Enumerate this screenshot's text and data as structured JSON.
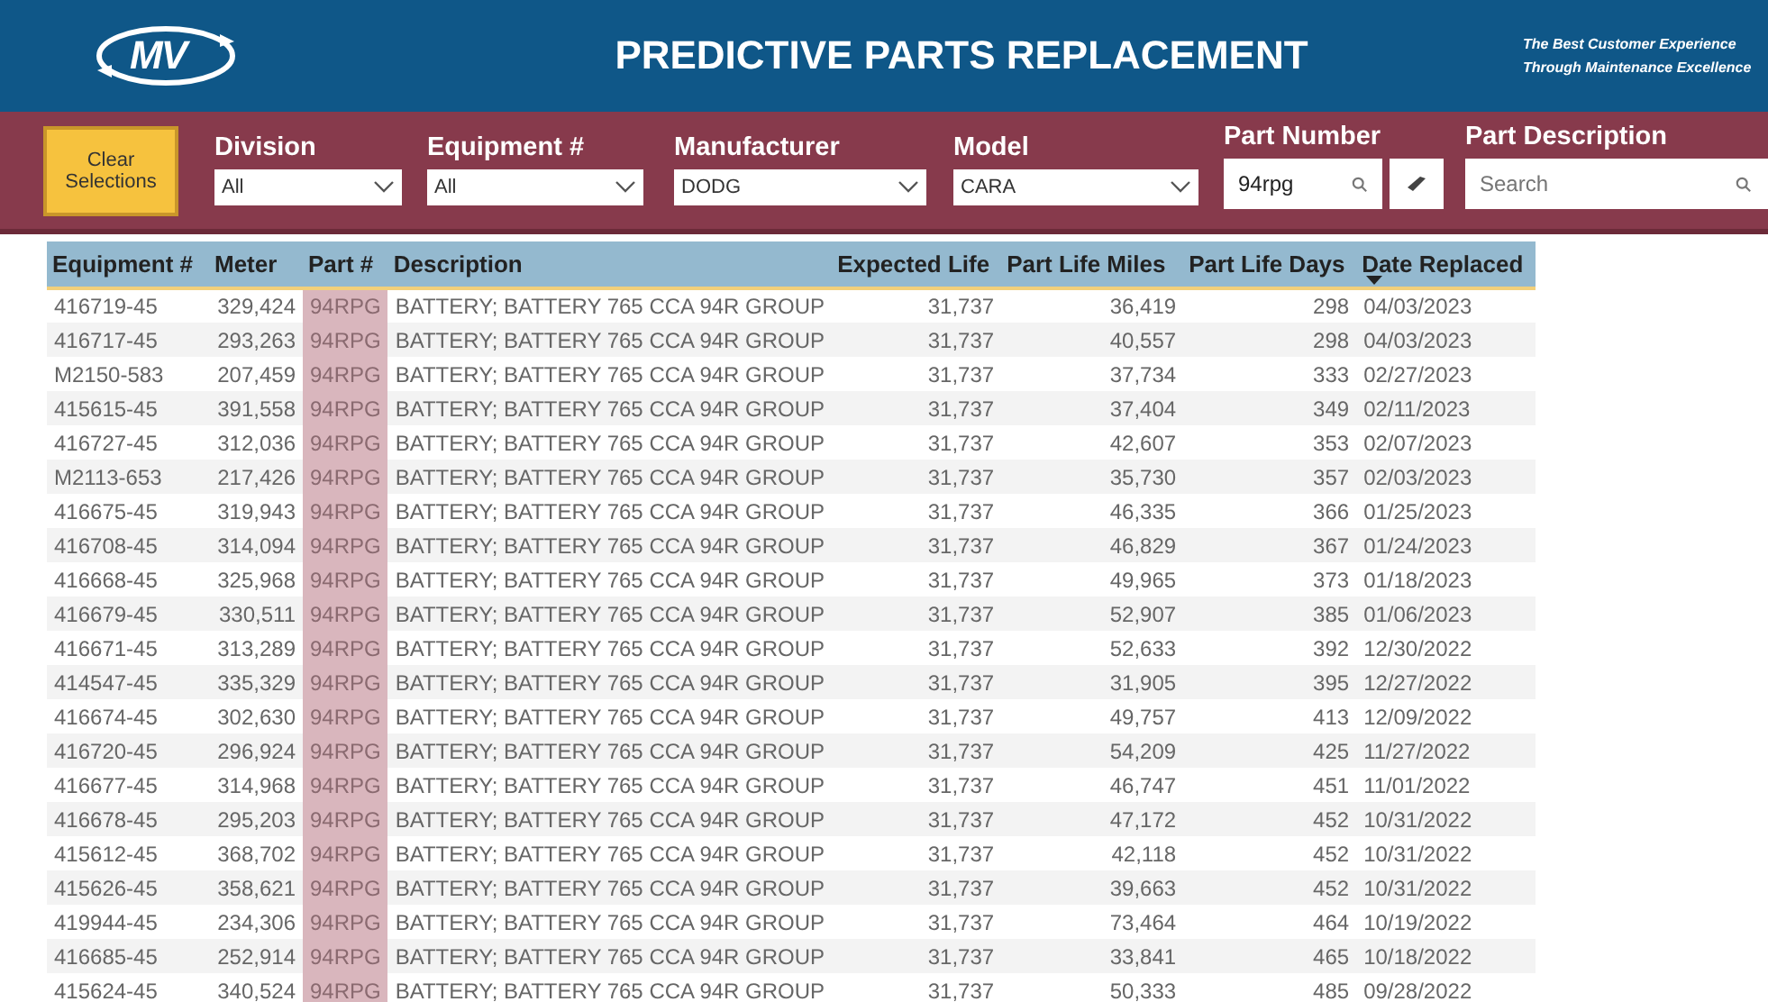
{
  "header": {
    "logo": "MV",
    "title": "PREDICTIVE PARTS REPLACEMENT",
    "tagline": [
      "The Best Customer Experience",
      "Through Maintenance Excellence"
    ]
  },
  "filters": {
    "clear_button": "Clear Selections",
    "dropdowns": [
      {
        "label": "Division",
        "value": "All"
      },
      {
        "label": "Equipment #",
        "value": "All"
      },
      {
        "label": "Manufacturer",
        "value": "DODG"
      },
      {
        "label": "Model",
        "value": "CARA"
      }
    ],
    "part_number": {
      "label": "Part Number",
      "value": "94rpg"
    },
    "part_description": {
      "label": "Part Description",
      "placeholder": "Search"
    }
  },
  "table": {
    "columns": [
      {
        "label": "Equipment #",
        "kind": "text",
        "sorted": false
      },
      {
        "label": "Meter",
        "kind": "number",
        "sorted": false
      },
      {
        "label": "Part #",
        "kind": "part",
        "sorted": false
      },
      {
        "label": "Description",
        "kind": "text",
        "sorted": false
      },
      {
        "label": "Expected Life",
        "kind": "number",
        "sorted": false
      },
      {
        "label": "Part Life Miles",
        "kind": "number",
        "sorted": false
      },
      {
        "label": "Part Life Days",
        "kind": "number",
        "sorted": false
      },
      {
        "label": "Date Replaced",
        "kind": "text",
        "sorted": true
      }
    ],
    "rows": [
      [
        "416719-45",
        "329,424",
        "94RPG",
        "BATTERY; BATTERY 765 CCA 94R GROUP",
        "31,737",
        "36,419",
        "298",
        "04/03/2023"
      ],
      [
        "416717-45",
        "293,263",
        "94RPG",
        "BATTERY; BATTERY 765 CCA 94R GROUP",
        "31,737",
        "40,557",
        "298",
        "04/03/2023"
      ],
      [
        "M2150-583",
        "207,459",
        "94RPG",
        "BATTERY; BATTERY 765 CCA 94R GROUP",
        "31,737",
        "37,734",
        "333",
        "02/27/2023"
      ],
      [
        "415615-45",
        "391,558",
        "94RPG",
        "BATTERY; BATTERY 765 CCA 94R GROUP",
        "31,737",
        "37,404",
        "349",
        "02/11/2023"
      ],
      [
        "416727-45",
        "312,036",
        "94RPG",
        "BATTERY; BATTERY 765 CCA 94R GROUP",
        "31,737",
        "42,607",
        "353",
        "02/07/2023"
      ],
      [
        "M2113-653",
        "217,426",
        "94RPG",
        "BATTERY; BATTERY 765 CCA 94R GROUP",
        "31,737",
        "35,730",
        "357",
        "02/03/2023"
      ],
      [
        "416675-45",
        "319,943",
        "94RPG",
        "BATTERY; BATTERY 765 CCA 94R GROUP",
        "31,737",
        "46,335",
        "366",
        "01/25/2023"
      ],
      [
        "416708-45",
        "314,094",
        "94RPG",
        "BATTERY; BATTERY 765 CCA 94R GROUP",
        "31,737",
        "46,829",
        "367",
        "01/24/2023"
      ],
      [
        "416668-45",
        "325,968",
        "94RPG",
        "BATTERY; BATTERY 765 CCA 94R GROUP",
        "31,737",
        "49,965",
        "373",
        "01/18/2023"
      ],
      [
        "416679-45",
        "330,511",
        "94RPG",
        "BATTERY; BATTERY 765 CCA 94R GROUP",
        "31,737",
        "52,907",
        "385",
        "01/06/2023"
      ],
      [
        "416671-45",
        "313,289",
        "94RPG",
        "BATTERY; BATTERY 765 CCA 94R GROUP",
        "31,737",
        "52,633",
        "392",
        "12/30/2022"
      ],
      [
        "414547-45",
        "335,329",
        "94RPG",
        "BATTERY; BATTERY 765 CCA 94R GROUP",
        "31,737",
        "31,905",
        "395",
        "12/27/2022"
      ],
      [
        "416674-45",
        "302,630",
        "94RPG",
        "BATTERY; BATTERY 765 CCA 94R GROUP",
        "31,737",
        "49,757",
        "413",
        "12/09/2022"
      ],
      [
        "416720-45",
        "296,924",
        "94RPG",
        "BATTERY; BATTERY 765 CCA 94R GROUP",
        "31,737",
        "54,209",
        "425",
        "11/27/2022"
      ],
      [
        "416677-45",
        "314,968",
        "94RPG",
        "BATTERY; BATTERY 765 CCA 94R GROUP",
        "31,737",
        "46,747",
        "451",
        "11/01/2022"
      ],
      [
        "416678-45",
        "295,203",
        "94RPG",
        "BATTERY; BATTERY 765 CCA 94R GROUP",
        "31,737",
        "47,172",
        "452",
        "10/31/2022"
      ],
      [
        "415612-45",
        "368,702",
        "94RPG",
        "BATTERY; BATTERY 765 CCA 94R GROUP",
        "31,737",
        "42,118",
        "452",
        "10/31/2022"
      ],
      [
        "415626-45",
        "358,621",
        "94RPG",
        "BATTERY; BATTERY 765 CCA 94R GROUP",
        "31,737",
        "39,663",
        "452",
        "10/31/2022"
      ],
      [
        "419944-45",
        "234,306",
        "94RPG",
        "BATTERY; BATTERY 765 CCA 94R GROUP",
        "31,737",
        "73,464",
        "464",
        "10/19/2022"
      ],
      [
        "416685-45",
        "252,914",
        "94RPG",
        "BATTERY; BATTERY 765 CCA 94R GROUP",
        "31,737",
        "33,841",
        "465",
        "10/18/2022"
      ],
      [
        "415624-45",
        "340,524",
        "94RPG",
        "BATTERY; BATTERY 765 CCA 94R GROUP",
        "31,737",
        "50,333",
        "485",
        "09/28/2022"
      ]
    ]
  }
}
